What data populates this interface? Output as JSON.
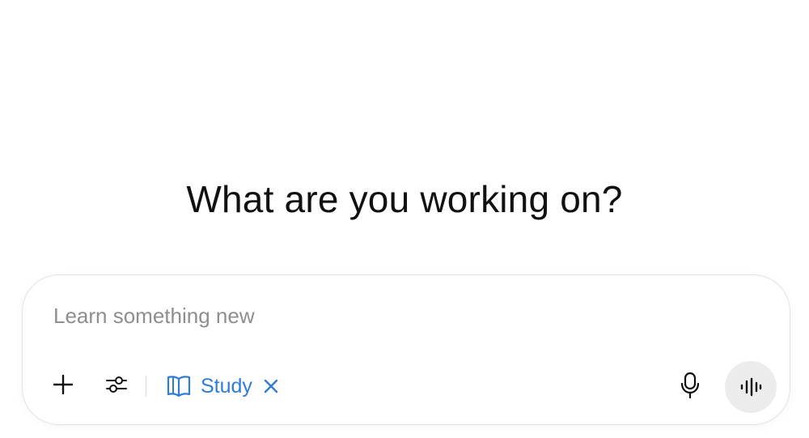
{
  "headline": "What are you working on?",
  "composer": {
    "placeholder": "Learn something new",
    "value": ""
  },
  "toolbar": {
    "add_icon": "plus-icon",
    "tools_icon": "sliders-icon",
    "mode_chip": {
      "label": "Study",
      "icon": "book-icon",
      "remove_icon": "close-icon",
      "color": "#2f7bd9"
    },
    "mic_icon": "microphone-icon",
    "voice_icon": "voice-waveform-icon"
  }
}
